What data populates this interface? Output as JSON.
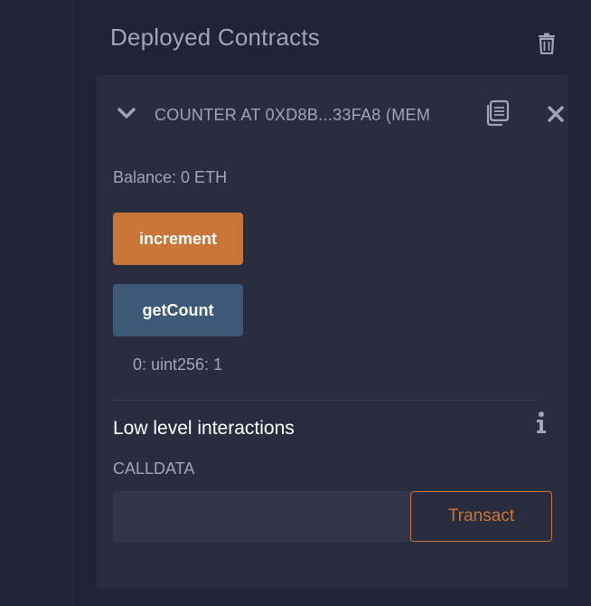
{
  "section": {
    "title": "Deployed Contracts"
  },
  "contract": {
    "name": "COUNTER AT 0XD8B...33FA8 (MEM",
    "balance": "Balance: 0 ETH",
    "functions": [
      {
        "label": "increment",
        "color": "#c97539"
      },
      {
        "label": "getCount",
        "color": "#3c5a78"
      }
    ],
    "result": "0: uint256: 1"
  },
  "low_level": {
    "title": "Low level interactions",
    "calldata_label": "CALLDATA",
    "calldata_value": "",
    "transact_label": "Transact"
  },
  "icons": {
    "trash": "trash-icon",
    "chevron": "chevron-down-icon",
    "copy": "copy-icon",
    "close": "close-icon",
    "info": "info-icon"
  },
  "colors": {
    "background": "#222336",
    "card": "#2a2c3f",
    "text_muted": "#a2a3bd",
    "accent_orange": "#c97539",
    "accent_blue": "#3c5a78"
  }
}
